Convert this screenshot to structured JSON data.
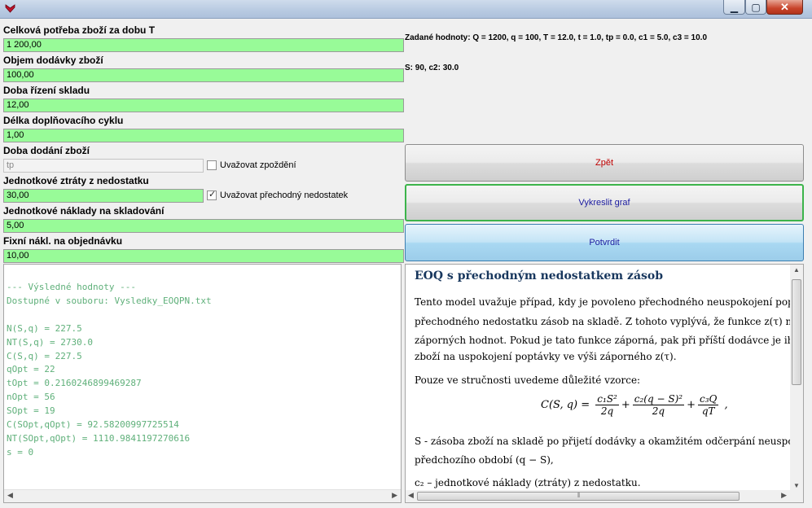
{
  "window": {
    "minimize_glyph": "▁",
    "maximize_glyph": "▢",
    "close_glyph": "✕"
  },
  "form": {
    "fields": [
      {
        "label": "Celková potřeba zboží za dobu T",
        "value": "1 200,00"
      },
      {
        "label": "Objem dodávky zboží",
        "value": "100,00"
      },
      {
        "label": "Doba řízení skladu",
        "value": "12,00"
      },
      {
        "label": "Délka doplňovacího cyklu",
        "value": "1,00"
      },
      {
        "label": "Doba dodání zboží",
        "value": "tp",
        "checkbox_label": "Uvažovat zpoždění",
        "checked": false
      },
      {
        "label": "Jednotkové ztráty z nedostatku",
        "value": "30,00",
        "checkbox_label": "Uvažovat přechodný nedostatek",
        "checked": true
      },
      {
        "label": "Jednotkové náklady na skladování",
        "value": "5,00"
      },
      {
        "label": "Fixní nákl. na objednávku",
        "value": "10,00"
      }
    ]
  },
  "info": {
    "given": "Zadané hodnoty: Q = 1200, q = 100, T = 12.0, t = 1.0, tp = 0.0, c1 = 5.0, c3 = 10.0",
    "extra": "S: 90, c2: 30.0"
  },
  "buttons": {
    "back": "Zpět",
    "graph": "Vykreslit graf",
    "confirm": "Potvrdit"
  },
  "results": {
    "lines": [
      "--- Výsledné hodnoty ---",
      "Dostupné v souboru: Vysledky_EOQPN.txt",
      "",
      "N(S,q) = 227.5",
      "NT(S,q) = 2730.0",
      "C(S,q) = 227.5",
      "qOpt = 22",
      "tOpt = 0.2160246899469287",
      "nOpt = 56",
      "SOpt = 19",
      "C(SOpt,qOpt) = 92.58200997725514",
      "NT(SOpt,qOpt) = 1110.9841197270616",
      "s = 0"
    ]
  },
  "description": {
    "title": "EOQ s přechodným nedostatkem zásob",
    "p1_line1": "Tento model uvažuje případ, kdy je povoleno přechodného neuspokojení poptávky, ne",
    "p1_line2": "přechodného nedostatku zásob na skladě. Z tohoto vyplývá, že funkce z(τ) může nabý",
    "p1_line3": "záporných hodnot. Pokud je tato funkce záporná, pak při příští dodávce je ihned odčerp",
    "p1_line4": "zboží na uspokojení poptávky ve výši záporného z(τ).",
    "p2": "Pouze ve stručnosti uvedeme důležité vzorce:",
    "formula_lhs": "C(S, q) =",
    "f1_num": "c₁S²",
    "f1_den": "2q",
    "f2_num": "c₂(q − S)²",
    "f2_den": "2q",
    "f3_num": "c₃Q",
    "f3_den": "qT",
    "p3_line1": "S - zásoba zboží na skladě po přijetí dodávky a okamžitém odčerpání neuspokojené popt",
    "p3_line2": "předchozího období (q − S),",
    "p4": "c₂ – jednotkové náklady (ztráty) z nedostatku."
  }
}
